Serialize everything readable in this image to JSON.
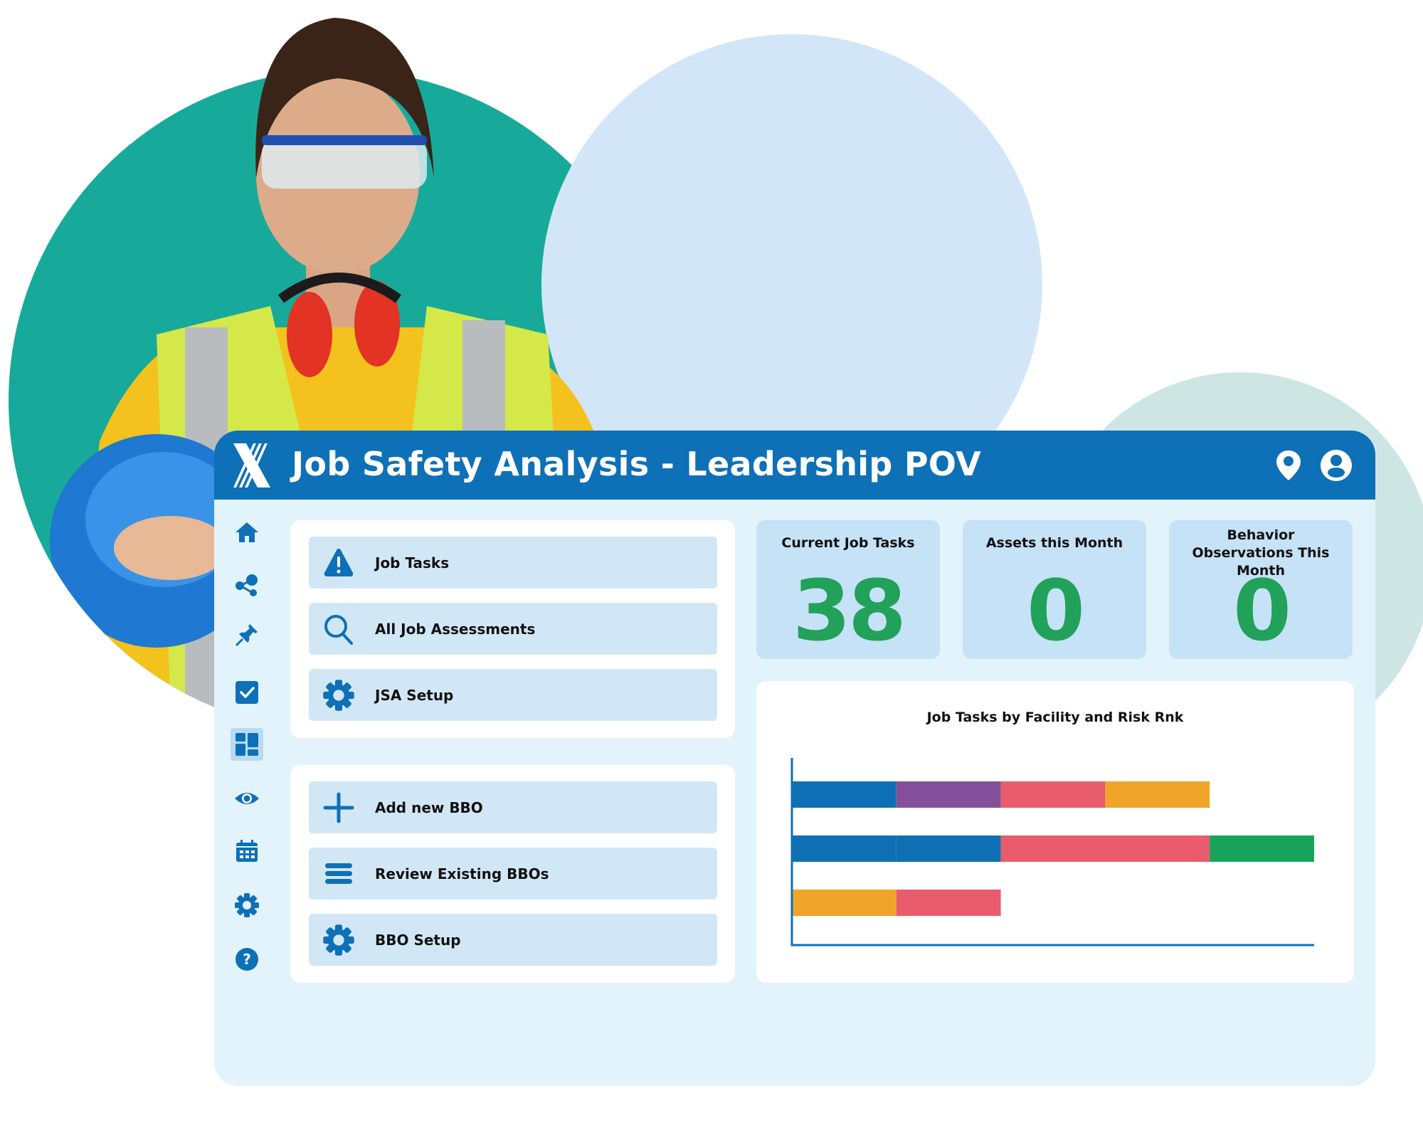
{
  "app": {
    "title": "Job Safety Analysis - Leadership POV",
    "logo": "x-logo-icon",
    "header_icons": [
      "location-pin-icon",
      "user-profile-icon"
    ]
  },
  "sidebar": {
    "items": [
      {
        "icon": "home-icon",
        "active": false
      },
      {
        "icon": "share-icon",
        "active": false
      },
      {
        "icon": "pin-icon",
        "active": false
      },
      {
        "icon": "checkbox-icon",
        "active": false
      },
      {
        "icon": "dashboard-icon",
        "active": true
      },
      {
        "icon": "eye-icon",
        "active": false
      },
      {
        "icon": "calendar-icon",
        "active": false
      },
      {
        "icon": "gear-icon",
        "active": false
      },
      {
        "icon": "help-icon",
        "active": false
      }
    ]
  },
  "jsa_menu": {
    "items": [
      {
        "label": "Job Tasks",
        "icon": "warning-icon"
      },
      {
        "label": "All Job Assessments",
        "icon": "search-icon"
      },
      {
        "label": "JSA Setup",
        "icon": "gear-icon"
      }
    ]
  },
  "bbo_menu": {
    "items": [
      {
        "label": "Add new BBO",
        "icon": "plus-icon"
      },
      {
        "label": "Review Existing BBOs",
        "icon": "list-icon"
      },
      {
        "label": "BBO Setup",
        "icon": "gear-icon"
      }
    ]
  },
  "stats": [
    {
      "label": "Current Job Tasks",
      "value": "38"
    },
    {
      "label": "Assets this Month",
      "value": "0"
    },
    {
      "label": "Behavior Observations This Month",
      "value": "0"
    }
  ],
  "colors": {
    "brand": "#0e70b7",
    "stat_value": "#21a15a",
    "risk_blue": "#0f6fb5",
    "risk_purple": "#84509c",
    "risk_red": "#e85c6c",
    "risk_orange": "#f0a52a",
    "risk_green": "#17a35a"
  },
  "chart_data": {
    "type": "bar",
    "orientation": "horizontal",
    "stacked": true,
    "title": "Job Tasks by Facility and Risk Rnk",
    "xlabel": "",
    "ylabel": "",
    "categories": [
      "",
      "",
      ""
    ],
    "xlim": [
      0,
      5
    ],
    "grid": false,
    "legend": "none",
    "bars": [
      {
        "segments": [
          {
            "color": "#0f6fb5",
            "value": 1
          },
          {
            "color": "#84509c",
            "value": 1
          },
          {
            "color": "#e85c6c",
            "value": 1
          },
          {
            "color": "#f0a52a",
            "value": 1
          }
        ]
      },
      {
        "segments": [
          {
            "color": "#0f6fb5",
            "value": 1
          },
          {
            "color": "#0f6fb5",
            "value": 1
          },
          {
            "color": "#e85c6c",
            "value": 2
          },
          {
            "color": "#17a35a",
            "value": 1
          }
        ]
      },
      {
        "segments": [
          {
            "color": "#f0a52a",
            "value": 1
          },
          {
            "color": "#e85c6c",
            "value": 1
          }
        ]
      }
    ]
  }
}
